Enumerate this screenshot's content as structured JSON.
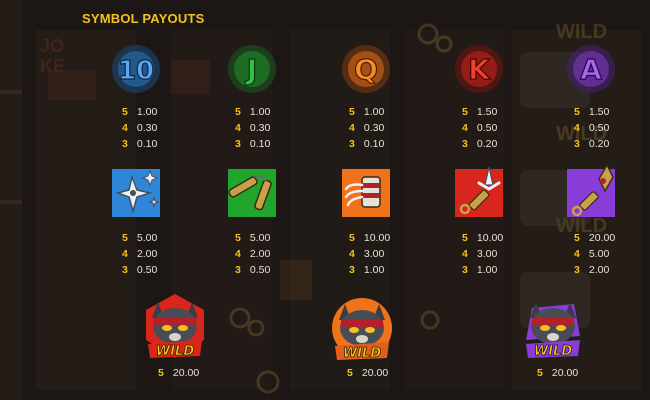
{
  "title": "SYMBOL PAYOUTS",
  "symbols": [
    {
      "id": "10",
      "letter": "10",
      "color": "#2f86d8",
      "payouts": [
        {
          "count": "5",
          "value": "1.00"
        },
        {
          "count": "4",
          "value": "0.30"
        },
        {
          "count": "3",
          "value": "0.10"
        }
      ]
    },
    {
      "id": "J",
      "letter": "J",
      "color": "#22a52c",
      "payouts": [
        {
          "count": "5",
          "value": "1.00"
        },
        {
          "count": "4",
          "value": "0.30"
        },
        {
          "count": "3",
          "value": "0.10"
        }
      ]
    },
    {
      "id": "Q",
      "letter": "Q",
      "color": "#f0731c",
      "payouts": [
        {
          "count": "5",
          "value": "1.00"
        },
        {
          "count": "4",
          "value": "0.30"
        },
        {
          "count": "3",
          "value": "0.10"
        }
      ]
    },
    {
      "id": "K",
      "letter": "K",
      "color": "#d9261c",
      "payouts": [
        {
          "count": "5",
          "value": "1.50"
        },
        {
          "count": "4",
          "value": "0.50"
        },
        {
          "count": "3",
          "value": "0.20"
        }
      ]
    },
    {
      "id": "A",
      "letter": "A",
      "color": "#8a3cd8",
      "payouts": [
        {
          "count": "5",
          "value": "1.50"
        },
        {
          "count": "4",
          "value": "0.50"
        },
        {
          "count": "3",
          "value": "0.20"
        }
      ]
    },
    {
      "id": "shuriken",
      "icon": "shuriken-icon",
      "color": "#2f86d8",
      "payouts": [
        {
          "count": "5",
          "value": "5.00"
        },
        {
          "count": "4",
          "value": "2.00"
        },
        {
          "count": "3",
          "value": "0.50"
        }
      ]
    },
    {
      "id": "nunchaku",
      "icon": "nunchaku-icon",
      "color": "#22a52c",
      "payouts": [
        {
          "count": "5",
          "value": "5.00"
        },
        {
          "count": "4",
          "value": "2.00"
        },
        {
          "count": "3",
          "value": "0.50"
        }
      ]
    },
    {
      "id": "claw",
      "icon": "claw-icon",
      "color": "#f0731c",
      "payouts": [
        {
          "count": "5",
          "value": "10.00"
        },
        {
          "count": "4",
          "value": "3.00"
        },
        {
          "count": "3",
          "value": "1.00"
        }
      ]
    },
    {
      "id": "sai",
      "icon": "sai-icon",
      "color": "#d9261c",
      "payouts": [
        {
          "count": "5",
          "value": "10.00"
        },
        {
          "count": "4",
          "value": "3.00"
        },
        {
          "count": "3",
          "value": "1.00"
        }
      ]
    },
    {
      "id": "kunai",
      "icon": "kunai-icon",
      "color": "#8a3cd8",
      "payouts": [
        {
          "count": "5",
          "value": "20.00"
        },
        {
          "count": "4",
          "value": "5.00"
        },
        {
          "count": "3",
          "value": "2.00"
        }
      ]
    }
  ],
  "wilds": [
    {
      "id": "wild-red",
      "label": "WILD",
      "color": "#d9261c",
      "payouts": [
        {
          "count": "5",
          "value": "20.00"
        }
      ]
    },
    {
      "id": "wild-orange",
      "label": "WILD",
      "color": "#f0731c",
      "payouts": [
        {
          "count": "5",
          "value": "20.00"
        }
      ]
    },
    {
      "id": "wild-purple",
      "label": "WILD",
      "color": "#8a3cd8",
      "payouts": [
        {
          "count": "5",
          "value": "20.00"
        }
      ]
    }
  ]
}
